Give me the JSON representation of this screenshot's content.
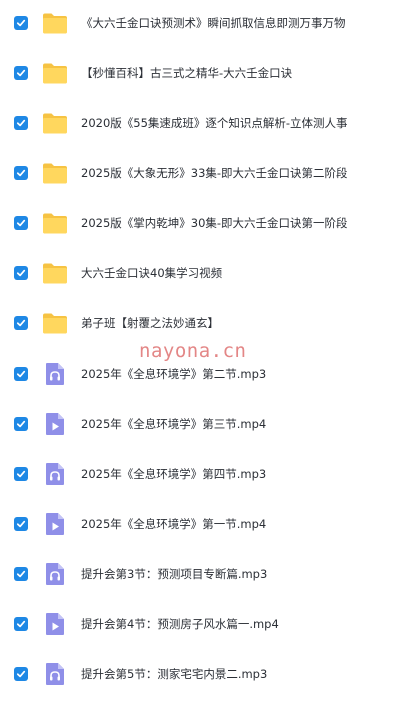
{
  "files": [
    {
      "name": "《大六壬金口诀预测术》瞬间抓取信息即测万事万物",
      "type": "folder",
      "checked": true
    },
    {
      "name": "【秒懂百科】古三式之精华-大六壬金口诀",
      "type": "folder",
      "checked": true
    },
    {
      "name": "2020版《55集速成班》逐个知识点解析-立体测人事",
      "type": "folder",
      "checked": true
    },
    {
      "name": "2025版《大象无形》33集-即大六壬金口诀第二阶段",
      "type": "folder",
      "checked": true
    },
    {
      "name": "2025版《掌内乾坤》30集-即大六壬金口诀第一阶段",
      "type": "folder",
      "checked": true
    },
    {
      "name": "大六壬金口诀40集学习视频",
      "type": "folder",
      "checked": true
    },
    {
      "name": "弟子班【射覆之法妙通玄】",
      "type": "folder",
      "checked": true
    },
    {
      "name": "2025年《全息环境学》第二节.mp3",
      "type": "audio",
      "checked": true
    },
    {
      "name": "2025年《全息环境学》第三节.mp4",
      "type": "video",
      "checked": true
    },
    {
      "name": "2025年《全息环境学》第四节.mp3",
      "type": "audio",
      "checked": true
    },
    {
      "name": "2025年《全息环境学》第一节.mp4",
      "type": "video",
      "checked": true
    },
    {
      "name": "提升会第3节：预测项目专断篇.mp3",
      "type": "audio",
      "checked": true
    },
    {
      "name": "提升会第4节：预测房子风水篇一.mp4",
      "type": "video",
      "checked": true
    },
    {
      "name": "提升会第5节：测家宅宅内景二.mp3",
      "type": "audio",
      "checked": true
    }
  ],
  "watermark": "nayona.cn",
  "colors": {
    "checkbox": "#1e88e5",
    "folder_back": "#f6c343",
    "folder_front": "#ffd75e",
    "media_file": "#8f8fe8",
    "media_fold": "#c4c4f5",
    "watermark": "#e07a7a"
  }
}
